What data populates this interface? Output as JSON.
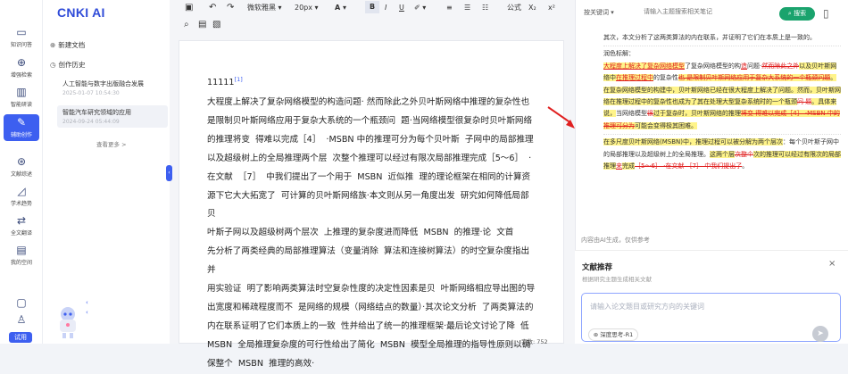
{
  "app": {
    "logo": "CNKI AI"
  },
  "rail": {
    "items": [
      {
        "label": "知识问答",
        "icon": "chat-icon"
      },
      {
        "label": "增强检索",
        "icon": "search-icon"
      },
      {
        "label": "智能研读",
        "icon": "book-icon"
      },
      {
        "label": "辅助创作",
        "icon": "pen-icon"
      },
      {
        "label": "文献综述",
        "icon": "target-icon"
      },
      {
        "label": "学术趋势",
        "icon": "chart-icon"
      },
      {
        "label": "全文翻译",
        "icon": "translate-icon"
      },
      {
        "label": "我的空间",
        "icon": "folder-icon"
      }
    ],
    "trial": "试用"
  },
  "history": {
    "new_doc": "新建文档",
    "history_label": "创作历史",
    "items": [
      {
        "title": "人工智能与数字出版融合发展",
        "date": "2025-01-07 10:54:30"
      },
      {
        "title": "智能汽车研究领域的应用",
        "date": "2024-09-24 05:44:09"
      }
    ],
    "more": "查看更多 >"
  },
  "toolbar": {
    "font": "微软雅黑",
    "size": "20px",
    "formula": "公式"
  },
  "editor": {
    "heading": "11111",
    "heading_ref": "[1]",
    "body": "大程度上解决了复杂网络模型的构造问题· 然而除此之外贝叶斯网络中推理的复杂性也\n是限制贝叶斯网络应用于复杂大系统的一个瓶颈问  题·当网络模型很复杂时贝叶斯网络\n的推理将变  得难以完成［4］  ·MSBN 中的推理可分为每个贝叶斯  子网中的局部推理\n以及超级树上的全局推理两个层  次整个推理可以经过有限次局部推理完成［5～6］  ·\n在文献  ［7］  中我们提出了一个用于  MSBN  近似推  理的理论框架在相同的计算资\n源下它大大拓宽了  可计算的贝叶斯网络族·本文则从另一角度出发  研究如何降低局部贝\n叶斯子网以及超级树两个层次  上推理的复杂度进而降低  MSBN  的推理·论  文首\n先分析了两类经典的局部推理算法（变量消除  算法和连接树算法）的时空复杂度指出并\n用实验证  明了影响两类算法时空复杂性度的决定性因素是贝  叶斯网络相应导出图的导\n出宽度和稀疏程度而不  是网络的规模（网络结点的数量）·其次论文分析  了两类算法的\n内在联系证明了它们本质上的一致  性并给出了统一的推理框架·最后论文讨论了降  低\nMSBN  全局推理复杂度的可行性给出了简化  MSBN  模型全局推理的指导性原则以确\n保整个  MSBN  推理的高效·",
    "word_count": "字数: 752"
  },
  "search": {
    "type": "按关键词",
    "placeholder": "请输入主题搜索相关笔记",
    "button": "搜索"
  },
  "ai_output": {
    "intro": "其次，本文分析了这两类算法的内在联系，并证明了它们在本质上是一致的。",
    "label": "润色标解：",
    "s1_del1": "大程度上解决",
    "s1_a": "大程度上解决了复杂网络模型",
    "s1_b": "了复杂网络模型的构",
    "s1_c": "造",
    "s1_d": "问题·",
    "s1_del2": "然而除此之外",
    "s1_e": "以及贝叶斯网络中",
    "s1_f": "在推理过程中",
    "s1_g": "的复杂性",
    "s1_del3": "也 是限制贝叶斯网络应用于复杂大系统的一个瓶颈问题",
    "s2": "。在复杂网络模型的构建中，贝叶斯网络已经在很大程度上解决了问题。然而，贝叶斯网络在推理过程中的复杂性也成为了其在处理大型复杂系统时的一个瓶颈",
    "s2_del": "问 题",
    "s2_b": "。具体来说，",
    "s2_c": "当网络模型",
    "s2_d": "很",
    "s2_e": "过于复杂时，贝叶斯网络的推理",
    "s2_del2": "将变 得难以完成［4］ ·MSBN 中的推理可分为",
    "s2_f": "可能会变得极其困难。",
    "s3": "在多尺度贝叶斯网络(MSBN)中，推理过程可以被分解为两个层次",
    "s3_b": "：每个贝叶斯子网中的局部推理以及超级树上的全局推理。",
    "s3_c": "这两个层",
    "s3_del": "次整个",
    "s3_d": "次的推理可以经过有限次的局部推理",
    "s3_e": "来",
    "s3_f": "完成",
    "s3_del2": "［5～6］ ·在文献 ［7］ 中我们提出了",
    "s3_g": "。"
  },
  "ai_note": "内容由AI生成，仅供参考",
  "recommend": {
    "title": "文献推荐",
    "subtitle": "根据研究主题生成相关文献",
    "placeholder": "请输入论文题目或研究方向的关键词",
    "chip": "深度思考-R1"
  }
}
